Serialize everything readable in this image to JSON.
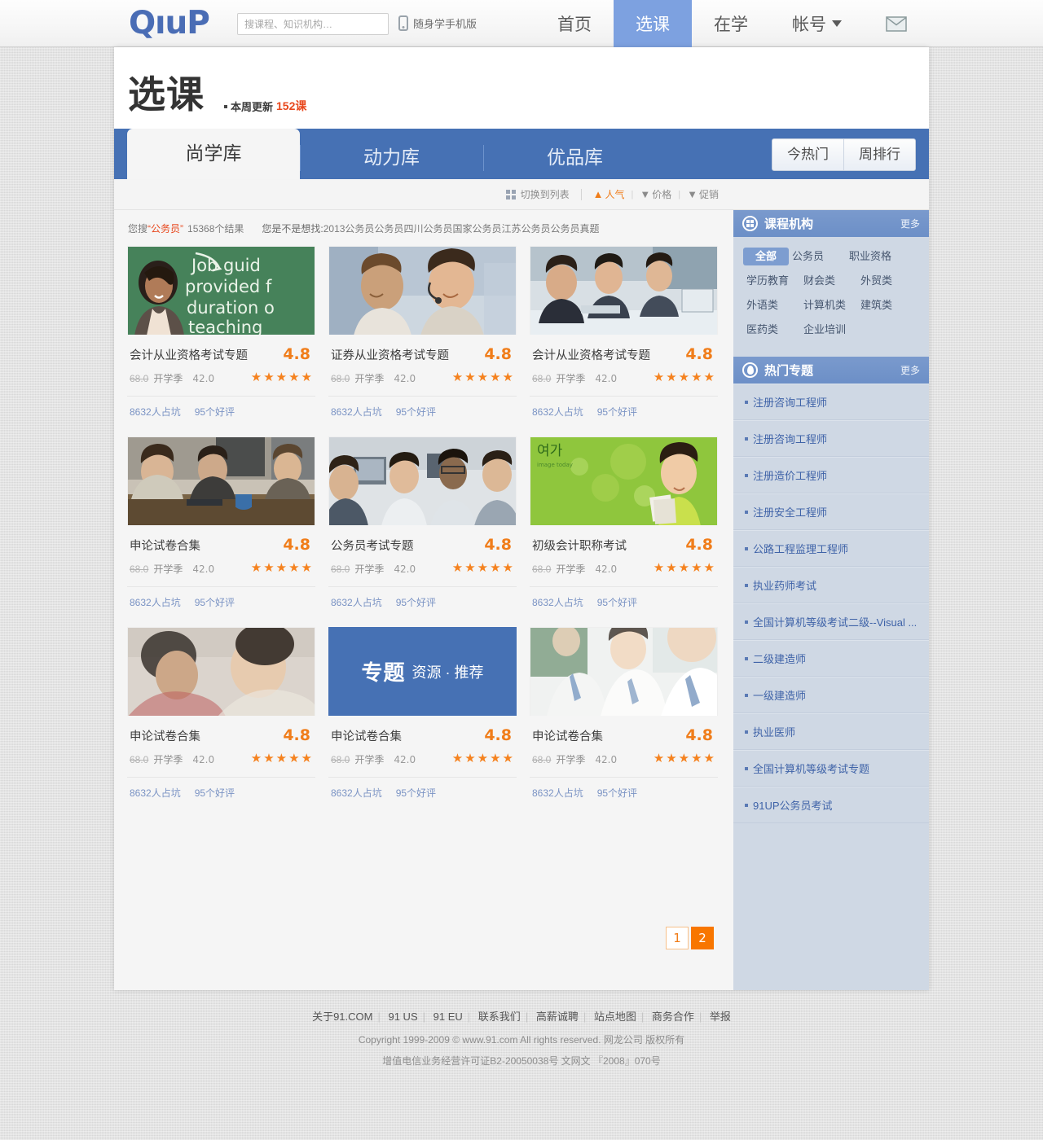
{
  "header": {
    "logo": "QıuP",
    "search_placeholder": "搜课程、知识机构…",
    "search_value": "",
    "mobile_label": "随身学手机版",
    "nav": [
      {
        "label": "首页",
        "active": false
      },
      {
        "label": "选课",
        "active": true
      },
      {
        "label": "在学",
        "active": false
      },
      {
        "label": "帐号",
        "active": false,
        "has_caret": true
      }
    ],
    "mail_icon": "envelope-icon"
  },
  "title": {
    "main": "选课",
    "sub": "本周更新",
    "count": "152课"
  },
  "tabs": [
    {
      "label": "尚学库",
      "active": true
    },
    {
      "label": "动力库",
      "active": false
    },
    {
      "label": "优品库",
      "active": false
    }
  ],
  "rank_buttons": [
    {
      "label": "今热门"
    },
    {
      "label": "周排行"
    }
  ],
  "sortbar": {
    "switch_label": "切换到列表",
    "options": [
      {
        "label": "人气",
        "arrow": "▲",
        "active": true
      },
      {
        "label": "价格",
        "arrow": "▼",
        "active": false
      },
      {
        "label": "促销",
        "arrow": "▼",
        "active": false
      }
    ]
  },
  "search_meta": {
    "prefix": "您搜",
    "keyword": "“公务员”",
    "results": "15368个结果",
    "suggest_label": "您是不是想找:",
    "suggestions": [
      "2013公务员公务员",
      "四川公务员",
      "国家公务员",
      "江苏公务员",
      "公务员真题"
    ]
  },
  "cards": [
    {
      "title": "会计从业资格考试专题",
      "score": "4.8",
      "old_price": "68.0",
      "season": "开学季",
      "price": "42.0",
      "stars": "★★★★★",
      "enrolled": "8632人占坑",
      "reviews": "95个好评",
      "image": "teacher-chalkboard"
    },
    {
      "title": "证券从业资格考试专题",
      "score": "4.8",
      "old_price": "68.0",
      "season": "开学季",
      "price": "42.0",
      "stars": "★★★★★",
      "enrolled": "8632人占坑",
      "reviews": "95个好评",
      "image": "headset-students"
    },
    {
      "title": "会计从业资格考试专题",
      "score": "4.8",
      "old_price": "68.0",
      "season": "开学季",
      "price": "42.0",
      "stars": "★★★★★",
      "enrolled": "8632人占坑",
      "reviews": "95个好评",
      "image": "office-computers"
    },
    {
      "title": "申论试卷合集",
      "score": "4.8",
      "old_price": "68.0",
      "season": "开学季",
      "price": "42.0",
      "stars": "★★★★★",
      "enrolled": "8632人占坑",
      "reviews": "95个好评",
      "image": "meeting-table"
    },
    {
      "title": "公务员考试专题",
      "score": "4.8",
      "old_price": "68.0",
      "season": "开学季",
      "price": "42.0",
      "stars": "★★★★★",
      "enrolled": "8632人占坑",
      "reviews": "95个好评",
      "image": "classroom-monitors"
    },
    {
      "title": "初级会计职称考试",
      "score": "4.8",
      "old_price": "68.0",
      "season": "开学季",
      "price": "42.0",
      "stars": "★★★★★",
      "enrolled": "8632人占坑",
      "reviews": "95个好评",
      "image": "green-girl-books"
    },
    {
      "title": "申论试卷合集",
      "score": "4.8",
      "old_price": "68.0",
      "season": "开学季",
      "price": "42.0",
      "stars": "★★★★★",
      "enrolled": "8632人占坑",
      "reviews": "95个好评",
      "image": "blurred-study"
    },
    {
      "title": "申论试卷合集",
      "score": "4.8",
      "old_price": "68.0",
      "season": "开学季",
      "price": "42.0",
      "stars": "★★★★★",
      "enrolled": "8632人占坑",
      "reviews": "95个好评",
      "image": "promo-banner"
    },
    {
      "title": "申论试卷合集",
      "score": "4.8",
      "old_price": "68.0",
      "season": "开学季",
      "price": "42.0",
      "stars": "★★★★★",
      "enrolled": "8632人占坑",
      "reviews": "95个好评",
      "image": "students-uniform"
    }
  ],
  "promo": {
    "big": "专题",
    "small": "资源 · 推荐"
  },
  "pagination": [
    {
      "label": "1",
      "current": false
    },
    {
      "label": "2",
      "current": true
    }
  ],
  "sidebar": {
    "org_panel": {
      "title": "课程机构",
      "more": "更多",
      "icon": "grid-icon",
      "categories": [
        {
          "label": "全部",
          "active": true
        },
        {
          "label": "公务员",
          "active": false
        },
        {
          "label": "职业资格",
          "active": false
        },
        {
          "label": "学历教育",
          "active": false
        },
        {
          "label": "财会类",
          "active": false
        },
        {
          "label": "外贸类",
          "active": false
        },
        {
          "label": "外语类",
          "active": false
        },
        {
          "label": "计算机类",
          "active": false
        },
        {
          "label": "建筑类",
          "active": false
        },
        {
          "label": "医药类",
          "active": false
        },
        {
          "label": "企业培训",
          "active": false
        }
      ]
    },
    "hot_panel": {
      "title": "热门专题",
      "more": "更多",
      "icon": "flame-icon",
      "items": [
        "注册咨询工程师",
        "注册咨询工程师",
        "注册造价工程师",
        "注册安全工程师",
        "公路工程监理工程师",
        "执业药师考试",
        "全国计算机等级考试二级--Visual ...",
        "二级建造师",
        "一级建造师",
        "执业医师",
        "全国计算机等级考试专题",
        "91UP公务员考试"
      ]
    }
  },
  "footer": {
    "links": [
      "关于91.COM",
      "91 US",
      "91 EU",
      "联系我们",
      "高薪诚聘",
      "站点地图",
      "商务合作",
      "举报"
    ],
    "copyright": "Copyright 1999-2009 © www.91.com All rights reserved. 网龙公司 版权所有",
    "icp": "增值电信业务经营许可证B2-20050038号 文网文 『2008』070号"
  },
  "colors": {
    "brand_blue": "#4671b4",
    "nav_active": "#7da1e0",
    "accent_orange": "#f87600",
    "score_orange": "#f07d1a",
    "link_blue": "#3f63a8"
  }
}
